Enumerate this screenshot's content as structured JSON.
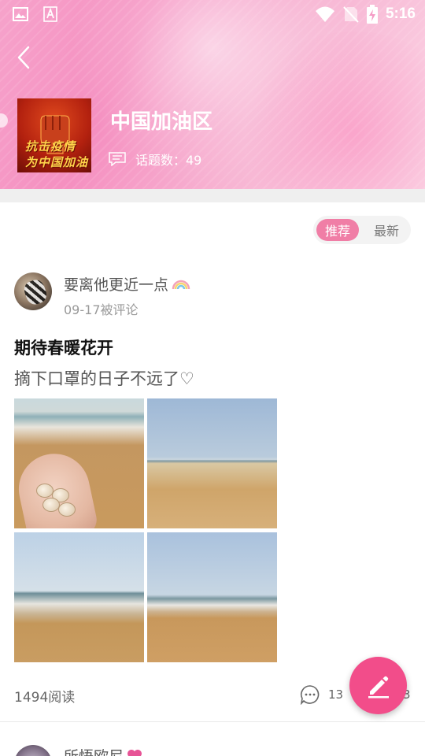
{
  "status_bar": {
    "time": "5:16",
    "left_icons": [
      "image-icon",
      "font-icon"
    ],
    "right_icons": [
      "wifi-icon",
      "no-sim-icon",
      "battery-charging-icon"
    ]
  },
  "header": {
    "back_icon": "chevron-left-icon",
    "topic_title": "中国加油区",
    "topic_count_label": "话题数：49",
    "cover_text_line1": "抗击疫情",
    "cover_text_line2": "为中国加油"
  },
  "sort_toggle": {
    "options": [
      "推荐",
      "最新"
    ],
    "selected": "推荐"
  },
  "posts": [
    {
      "author": "要离他更近一点",
      "author_emoji": "rainbow-icon",
      "meta": "09-17被评论",
      "title": "期待春暖花开",
      "body": "摘下口罩的日子不远了♡",
      "images": [
        "beach-photo-hand-shells",
        "beach-photo-shore",
        "beach-photo-waves",
        "beach-photo-horizon"
      ],
      "reads": "1494阅读",
      "comments": "13",
      "likes": "3"
    },
    {
      "author": "所悟欧尼",
      "author_emoji": "heart-icon"
    }
  ],
  "fab": {
    "icon": "pencil-icon"
  },
  "colors": {
    "accent_pink": "#f24d8a",
    "toggle_active": "#f07ea6",
    "banner_pink": "#f58fc0"
  }
}
